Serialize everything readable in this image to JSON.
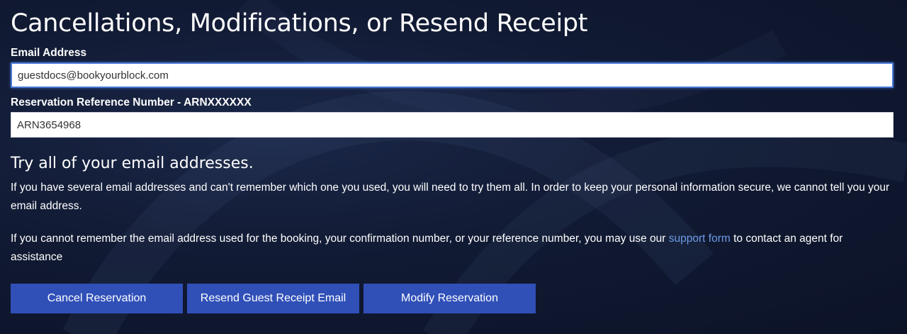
{
  "page": {
    "title": "Cancellations, Modifications, or Resend Receipt"
  },
  "form": {
    "email_label": "Email Address",
    "email_value": "guestdocs@bookyourblock.com",
    "reference_label": "Reservation Reference Number - ARNXXXXXX",
    "reference_value": "ARN3654968"
  },
  "info": {
    "heading": "Try all of your email addresses.",
    "paragraph1": "If you have several email addresses and can't remember which one you used, you will need to try them all. In order to keep your personal information secure, we cannot tell you your email address.",
    "paragraph2_before": "If you cannot remember the email address used for the booking, your confirmation number, or your reference number, you may use our ",
    "support_link": "support form",
    "paragraph2_after": " to contact an agent for assistance"
  },
  "actions": {
    "cancel_label": "Cancel Reservation",
    "resend_label": "Resend Guest Receipt Email",
    "modify_label": "Modify Reservation"
  },
  "colors": {
    "background": "#111a33",
    "button": "#3050b8",
    "link": "#6e9be6",
    "focus_border": "#4a78d6"
  }
}
